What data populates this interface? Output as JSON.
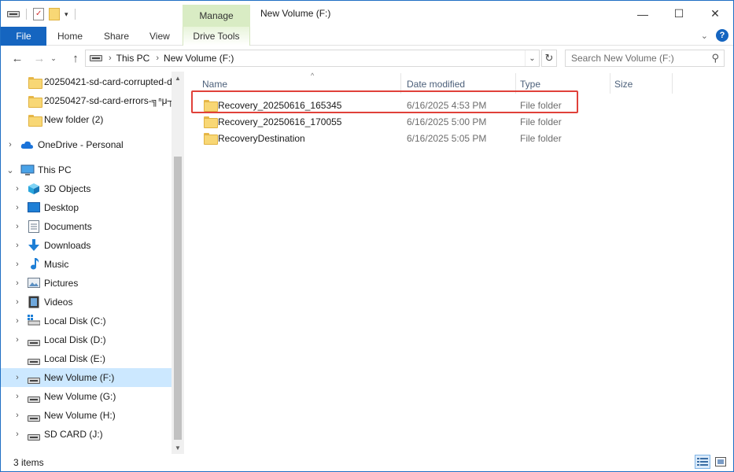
{
  "window": {
    "title": "New Volume (F:)",
    "contextual_group": "Manage",
    "controls": {
      "minimize": "—",
      "maximize": "☐",
      "close": "✕"
    }
  },
  "ribbon": {
    "tabs": [
      {
        "label": "File"
      },
      {
        "label": "Home"
      },
      {
        "label": "Share"
      },
      {
        "label": "View"
      },
      {
        "label": "Drive Tools"
      }
    ],
    "expand_icon": "chevron-down-icon",
    "help_label": "?"
  },
  "address_bar": {
    "breadcrumbs": [
      "This PC",
      "New Volume (F:)"
    ],
    "search_placeholder": "Search New Volume (F:)"
  },
  "nav_pane": {
    "items": [
      {
        "label": "20250421-sd-card-corrupted-d",
        "icon": "folder-icon"
      },
      {
        "label": "20250427-sd-card-errors-╗ⁿμ┬",
        "icon": "folder-icon"
      },
      {
        "label": "New folder (2)",
        "icon": "folder-icon"
      },
      {
        "label": "OneDrive - Personal",
        "icon": "cloud-icon"
      },
      {
        "label": "This PC",
        "icon": "computer-icon"
      },
      {
        "label": "3D Objects",
        "icon": "cube-icon"
      },
      {
        "label": "Desktop",
        "icon": "desktop-icon"
      },
      {
        "label": "Documents",
        "icon": "documents-icon"
      },
      {
        "label": "Downloads",
        "icon": "download-icon"
      },
      {
        "label": "Music",
        "icon": "music-icon"
      },
      {
        "label": "Pictures",
        "icon": "pictures-icon"
      },
      {
        "label": "Videos",
        "icon": "videos-icon"
      },
      {
        "label": "Local Disk (C:)",
        "icon": "system-drive-icon"
      },
      {
        "label": "Local Disk (D:)",
        "icon": "drive-icon"
      },
      {
        "label": "Local Disk (E:)",
        "icon": "drive-icon"
      },
      {
        "label": "New Volume (F:)",
        "icon": "drive-icon",
        "selected": true
      },
      {
        "label": "New Volume (G:)",
        "icon": "drive-icon"
      },
      {
        "label": "New Volume (H:)",
        "icon": "drive-icon"
      },
      {
        "label": "SD CARD (J:)",
        "icon": "drive-icon"
      }
    ]
  },
  "file_list": {
    "columns": [
      "Name",
      "Date modified",
      "Type",
      "Size"
    ],
    "rows": [
      {
        "name": "Recovery_20250616_165345",
        "date": "6/16/2025 4:53 PM",
        "type": "File folder",
        "highlighted": true
      },
      {
        "name": "Recovery_20250616_170055",
        "date": "6/16/2025 5:00 PM",
        "type": "File folder"
      },
      {
        "name": "RecoveryDestination",
        "date": "6/16/2025 5:05 PM",
        "type": "File folder"
      }
    ]
  },
  "status_bar": {
    "item_count": "3 items"
  },
  "colors": {
    "accent": "#1565c0",
    "manage_tab": "#d9ecc4",
    "selection": "#cce8ff",
    "highlight_border": "#e0413a"
  }
}
